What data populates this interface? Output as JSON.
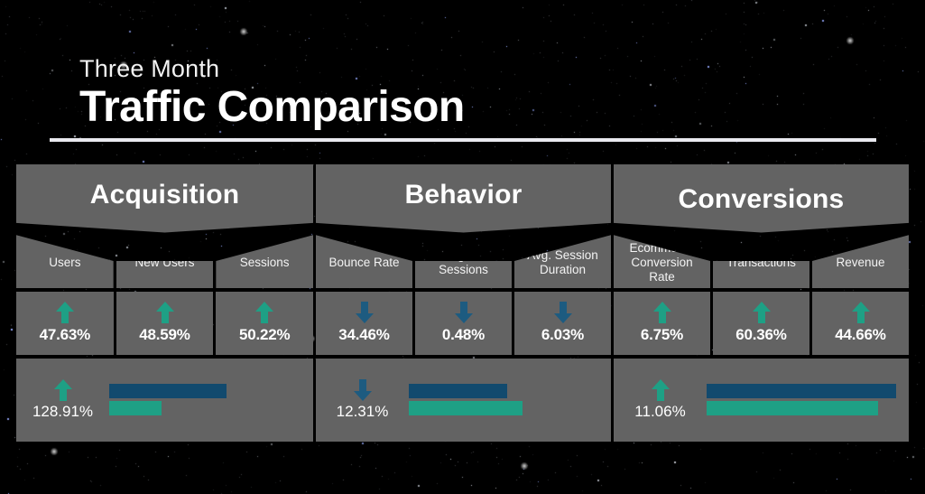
{
  "title": {
    "eyebrow": "Three Month",
    "main": "Traffic Comparison"
  },
  "colors": {
    "background": "#000000",
    "panel": "#636363",
    "up_arrow": "#1ea085",
    "down_arrow": "#1d5b80",
    "bar_blue": "#124a6e",
    "bar_teal": "#1ea085",
    "text": "#ffffff"
  },
  "chart_data": {
    "type": "table",
    "title": "Three Month Traffic Comparison",
    "groups": [
      {
        "name": "Acquisition",
        "metrics": [
          {
            "label": "Users",
            "value": "47.63%",
            "direction": "up"
          },
          {
            "label": "New Users",
            "value": "48.59%",
            "direction": "up"
          },
          {
            "label": "Sessions",
            "value": "50.22%",
            "direction": "up"
          }
        ],
        "summary": {
          "value": "128.91%",
          "direction": "up",
          "bar_blue_pct": 60,
          "bar_teal_pct": 27
        }
      },
      {
        "name": "Behavior",
        "metrics": [
          {
            "label": "Bounce Rate",
            "value": "34.46%",
            "direction": "down"
          },
          {
            "label": "Pages / Sessions",
            "value": "0.48%",
            "direction": "down"
          },
          {
            "label": "Avg. Session Duration",
            "value": "6.03%",
            "direction": "down"
          }
        ],
        "summary": {
          "value": "12.31%",
          "direction": "down",
          "bar_blue_pct": 51,
          "bar_teal_pct": 59
        }
      },
      {
        "name": "Conversions",
        "metrics": [
          {
            "label": "Ecommerce Conversion Rate",
            "value": "6.75%",
            "direction": "up"
          },
          {
            "label": "Transactions",
            "value": "60.36%",
            "direction": "up"
          },
          {
            "label": "Revenue",
            "value": "44.66%",
            "direction": "up"
          }
        ],
        "summary": {
          "value": "11.06%",
          "direction": "up",
          "bar_blue_pct": 98,
          "bar_teal_pct": 89
        }
      }
    ]
  }
}
